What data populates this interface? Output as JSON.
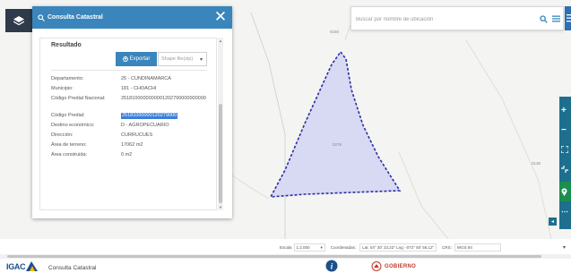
{
  "panel": {
    "title": "Consulta Catastral",
    "close_label": "✕",
    "result_heading": "Resultado",
    "export_label": "Exportar",
    "format_placeholder": "Shape file(zip)",
    "rows": [
      {
        "label": "Departamento:",
        "value": "25 - CUNDINAMARCA"
      },
      {
        "label": "Municipio:",
        "value": "181 - CHOACHÍ"
      },
      {
        "label": "Código Predial Nacional:",
        "value": "2518100000000001202790000000000"
      },
      {
        "label": "Código Predial:",
        "value": "25181000000120279000"
      },
      {
        "label": "Destino económico:",
        "value": "D - AGROPECUARIO"
      },
      {
        "label": "Dirección:",
        "value": "CURRUCUES"
      },
      {
        "label": "Área de terreno:",
        "value": "17062 m2"
      },
      {
        "label": "Área construida:",
        "value": "0 m2"
      }
    ]
  },
  "search": {
    "placeholder": "Buscar por nombre de ubicación"
  },
  "map": {
    "labels": {
      "top": "0150",
      "parcel": "0279",
      "right": "0136"
    },
    "parcel_fill": "#d8d9f2",
    "parcel_stroke": "#2b2fa3"
  },
  "status_bar": {
    "scale_label": "Escala",
    "scale_value": "1:2.000",
    "coords_label": "Coordenadas:",
    "coords_value": "Lat: 04° 30' 23,22\" Lng: -073° 50' 56,12\"",
    "crs_label": "CRS:",
    "crs_value": "WGS 84"
  },
  "footer": {
    "logo_text": "IGAC",
    "app_name": "Consulta Catastral",
    "gov_text": "GOBIERNO"
  },
  "colors": {
    "header_blue": "#3a85bb",
    "toolbar_teal": "#1e6f8e",
    "active_green": "#1c8f4f",
    "highlight": "#3b7fd9"
  }
}
